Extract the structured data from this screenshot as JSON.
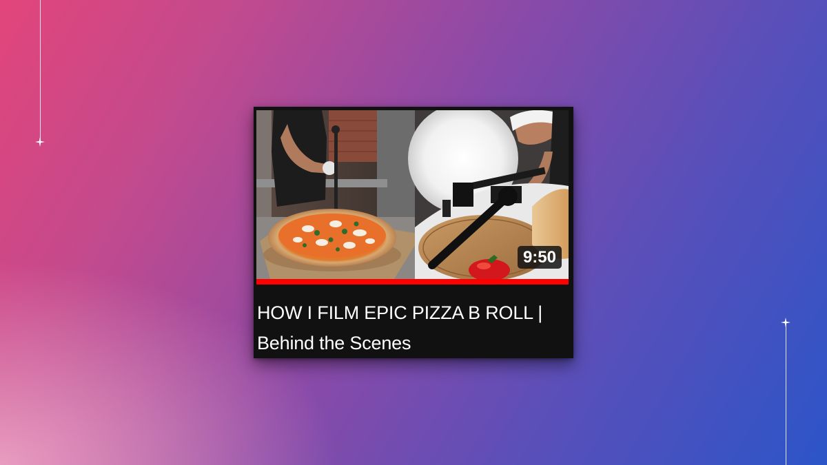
{
  "video_card": {
    "duration": "9:50",
    "title": "HOW I FILM EPIC PIZZA B ROLL | Behind the Scenes",
    "watch_progress": 1.0,
    "thumbnail": {
      "description_icon": "pizza-bts-thumbnail"
    }
  },
  "colors": {
    "progress": "#ff0000",
    "card_bg": "#111111",
    "title_text": "#ffffff"
  }
}
